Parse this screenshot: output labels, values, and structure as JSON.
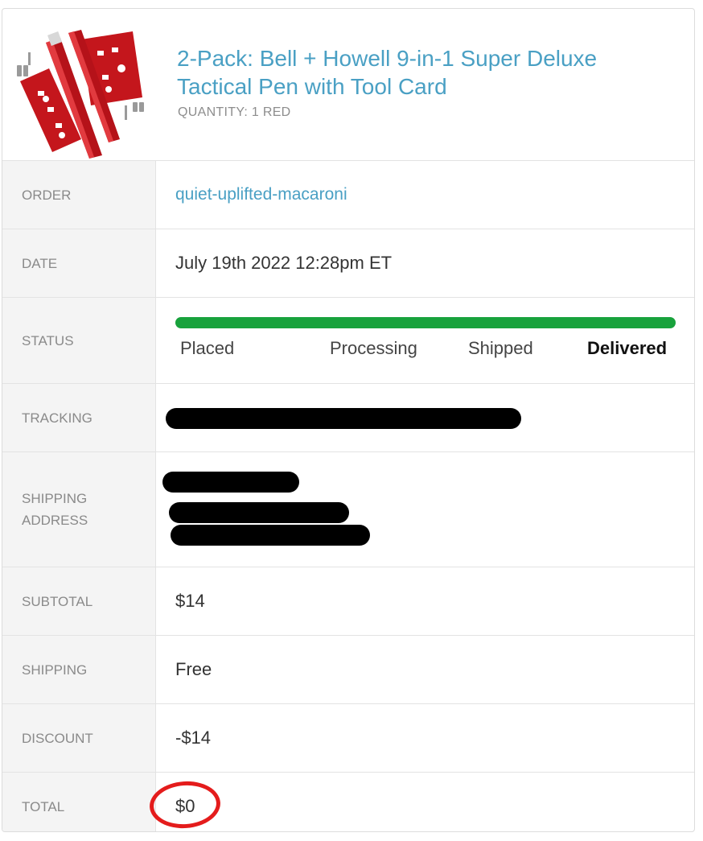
{
  "product": {
    "title": "2-Pack: Bell + Howell 9-in-1 Super Deluxe Tactical Pen with Tool Card",
    "quantity": "QUANTITY: 1 RED",
    "image": "red-tactical-pen-and-tool-card-image"
  },
  "rows": {
    "order": {
      "label": "ORDER",
      "value": "quiet-uplifted-macaroni"
    },
    "date": {
      "label": "DATE",
      "value": "July 19th 2022 12:28pm ET"
    },
    "status": {
      "label": "STATUS",
      "steps": [
        "Placed",
        "Processing",
        "Shipped",
        "Delivered"
      ],
      "current": "Delivered",
      "progress_percent": 100,
      "bar_color": "#18a23c"
    },
    "tracking": {
      "label": "TRACKING",
      "value_redacted": true
    },
    "shipping_address": {
      "label": "SHIPPING ADDRESS",
      "value_redacted": true
    },
    "subtotal": {
      "label": "SUBTOTAL",
      "value": "$14"
    },
    "shipping": {
      "label": "SHIPPING",
      "value": "Free"
    },
    "discount": {
      "label": "DISCOUNT",
      "value": "-$14"
    },
    "total": {
      "label": "TOTAL",
      "value": "$0",
      "annotation_color": "#e41c1c"
    }
  },
  "colors": {
    "link": "#4aa0c4",
    "label_bg": "#f4f4f4"
  }
}
